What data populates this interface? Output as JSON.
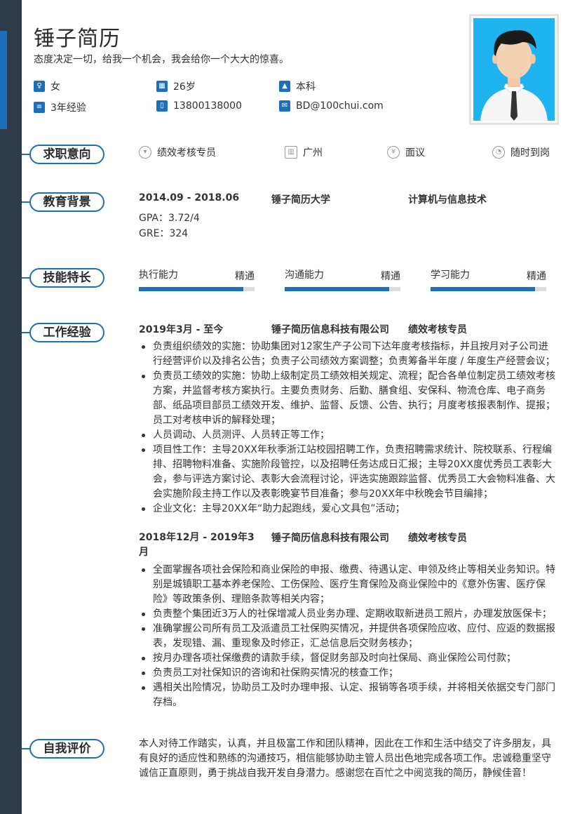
{
  "header": {
    "name": "锤子简历",
    "motto": "态度决定一切，给我一个机会，我会给你一个大大的惊喜。"
  },
  "basic_info": {
    "gender": "女",
    "age": "26岁",
    "degree": "本科",
    "experience": "3年经验",
    "phone": "13800138000",
    "email": "BD@100chui.com"
  },
  "sections": {
    "intent": "求职意向",
    "education": "教育背景",
    "skills": "技能特长",
    "work": "工作经验",
    "self": "自我评价"
  },
  "intent": {
    "position": "绩效考核专员",
    "city": "广州",
    "salary": "面议",
    "availability": "随时到岗"
  },
  "education": {
    "period": "2014.09 - 2018.06",
    "school": "锤子简历大学",
    "major": "计算机与信息技术",
    "gpa": "GPA：3.72/4",
    "gre": "GRE：324"
  },
  "skills": [
    {
      "name": "执行能力",
      "level": "精通",
      "fill": 0.9
    },
    {
      "name": "沟通能力",
      "level": "精通",
      "fill": 0.9
    },
    {
      "name": "学习能力",
      "level": "精通",
      "fill": 0.9
    }
  ],
  "work": [
    {
      "period": "2019年3月 - 至今",
      "company": "锤子简历信息科技有限公司",
      "title": "绩效考核专员",
      "items": [
        "负责组织绩效的实施：协助集团对12家生产子公司下达年度考核指标，并且按月对子公司进行经营评价以及排名公告；负责子公司绩效方案调整；负责筹备半年度 / 年度生产经营会议；",
        "负责员工绩效的实施：协助上级制定员工绩效相关规定、流程；配合各单位制定员工绩效考核方案，并监督考核方案执行。主要负责财务、后勤、膳食组、安保科、物流仓库、电子商务部、纸品项目部员工绩效开发、维护、监督、反馈、公告、执行；月度考核报表制作、提报；员工对考核申诉的解释处理；",
        "人员调动、人员测评、人员转正等工作；",
        "项目性工作：主导20XX年秋季浙江站校园招聘工作，负责招聘需求统计、院校联系、行程编排、招聘物料准备、实施阶段管控，以及招聘任务达成日汇报；主导20XX度优秀员工表彰大会，参与评选方案讨论、表彰大会流程讨论，评选实施跟踪监督、优秀员工大会物料准备、大会实施阶段主持工作以及表彰晚宴节目准备；参与20XX年中秋晚会节目编排；",
        "企业文化：主导20XX年“助力起跑线，爱心文具包”活动；"
      ]
    },
    {
      "period": "2018年12月 - 2019年3月",
      "company": "锤子简历信息科技有限公司",
      "title": "绩效考核专员",
      "items": [
        "全面掌握各项社会保险和商业保险的申报、缴费、待遇认定、申领及终止等相关业务知识。特别是城镇职工基本养老保险、工伤保险、医疗生育保险及商业保险中的《意外伤害、医疗保险》等政策条例、理赔条款等相关内容；",
        "负责整个集团近3万人的社保增减人员业务办理、定期收取新进员工照片，办理发放医保卡；",
        "准确掌握公司所有员工及派遣员工社保购买情况，并提供各项保险应收、应付、应返的数据报表，发现错、漏、重现象及时修正，汇总信息后交财务核办；",
        "按月办理各项社保缴费的请款手续，督促财务部及时向社保局、商业保险公司付款；",
        "负责员工对社保知识的咨询和社保购买情况的核查工作；",
        "遇相关出险情况，协助员工及时办理申报、认定、报销等各项手续，并将相关依据交专门部门存档。"
      ]
    }
  ],
  "self_evaluation": "本人对待工作踏实，认真，并且极富工作和团队精神，因此在工作和生活中结交了许多朋友，具有良好的适应性和熟练的沟通技巧，相信能够协助主管人员出色地完成各项工作。忠诚稳重坚守诚信正直原则，勇于挑战自我开发自身潜力。感谢您在百忙之中阅览我的简历，静候佳音！",
  "icons": {
    "gender": "gender-icon",
    "age": "calendar-icon",
    "degree": "graduation-cap-icon",
    "experience": "document-icon",
    "phone": "phone-icon",
    "email": "mail-icon",
    "position": "tie-icon",
    "city": "building-icon",
    "salary": "yen-icon",
    "availability": "clock-icon"
  },
  "colors": {
    "accent": "#1f6fb8",
    "sidebar": "#2f3a4a",
    "photo_bg": "#1fb4f0"
  }
}
